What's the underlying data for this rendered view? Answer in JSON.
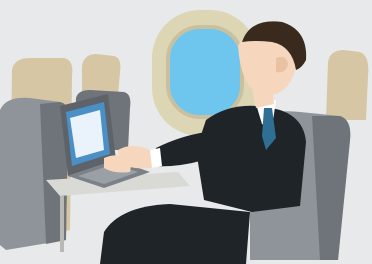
{
  "scene": {
    "subject": "businessman-using-laptop-on-airplane",
    "colors": {
      "wall": "#e8e9ea",
      "window_frame": "#ddd6b5",
      "window_glass": "#6ec6ee",
      "seat_gray": "#8e9499",
      "seat_dark": "#6e7479",
      "seat_tan": "#d6c6a4",
      "suit": "#1f2428",
      "shirt": "#ffffff",
      "tie": "#2f6f93",
      "skin": "#f6d7bd",
      "hair": "#3a2a1e",
      "laptop": "#5d6369",
      "laptop_screen": "#4a8fc6",
      "tray": "#d9d9d6"
    }
  }
}
